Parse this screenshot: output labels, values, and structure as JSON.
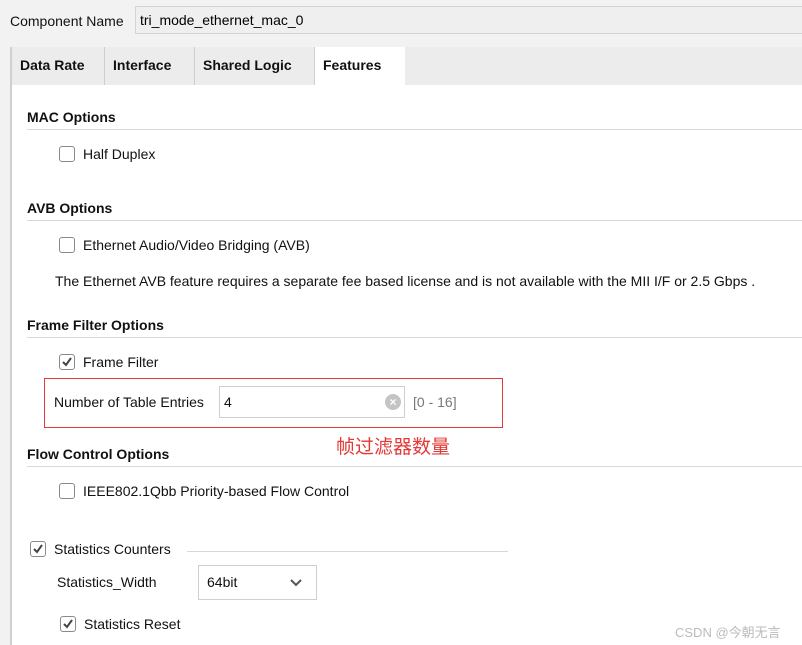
{
  "component_name": {
    "label": "Component Name",
    "value": "tri_mode_ethernet_mac_0"
  },
  "tabs": [
    {
      "label": "Data Rate"
    },
    {
      "label": "Interface"
    },
    {
      "label": "Shared Logic"
    },
    {
      "label": "Features",
      "active": true
    }
  ],
  "mac": {
    "title": "MAC Options",
    "half_duplex": {
      "label": "Half Duplex",
      "checked": false
    }
  },
  "avb": {
    "title": "AVB Options",
    "avb": {
      "label": "Ethernet Audio/Video Bridging (AVB)",
      "checked": false
    },
    "note": "The Ethernet AVB feature requires a separate fee based license and is not available with the MII I/F or 2.5 Gbps ."
  },
  "frame_filter": {
    "title": "Frame Filter Options",
    "frame_filter": {
      "label": "Frame Filter",
      "checked": true
    },
    "entries_label": "Number of Table Entries",
    "entries_value": "4",
    "entries_range": "[0 - 16]",
    "annotation": "帧过滤器数量"
  },
  "flow": {
    "title": "Flow Control Options",
    "pfc": {
      "label": "IEEE802.1Qbb Priority-based Flow Control",
      "checked": false
    }
  },
  "stats": {
    "counters": {
      "label": "Statistics Counters",
      "checked": true
    },
    "width_label": "Statistics_Width",
    "width_value": "64bit",
    "reset": {
      "label": "Statistics Reset",
      "checked": true
    }
  },
  "watermark": "CSDN @今朝无言",
  "colors": {
    "annotation": "#e53935"
  }
}
